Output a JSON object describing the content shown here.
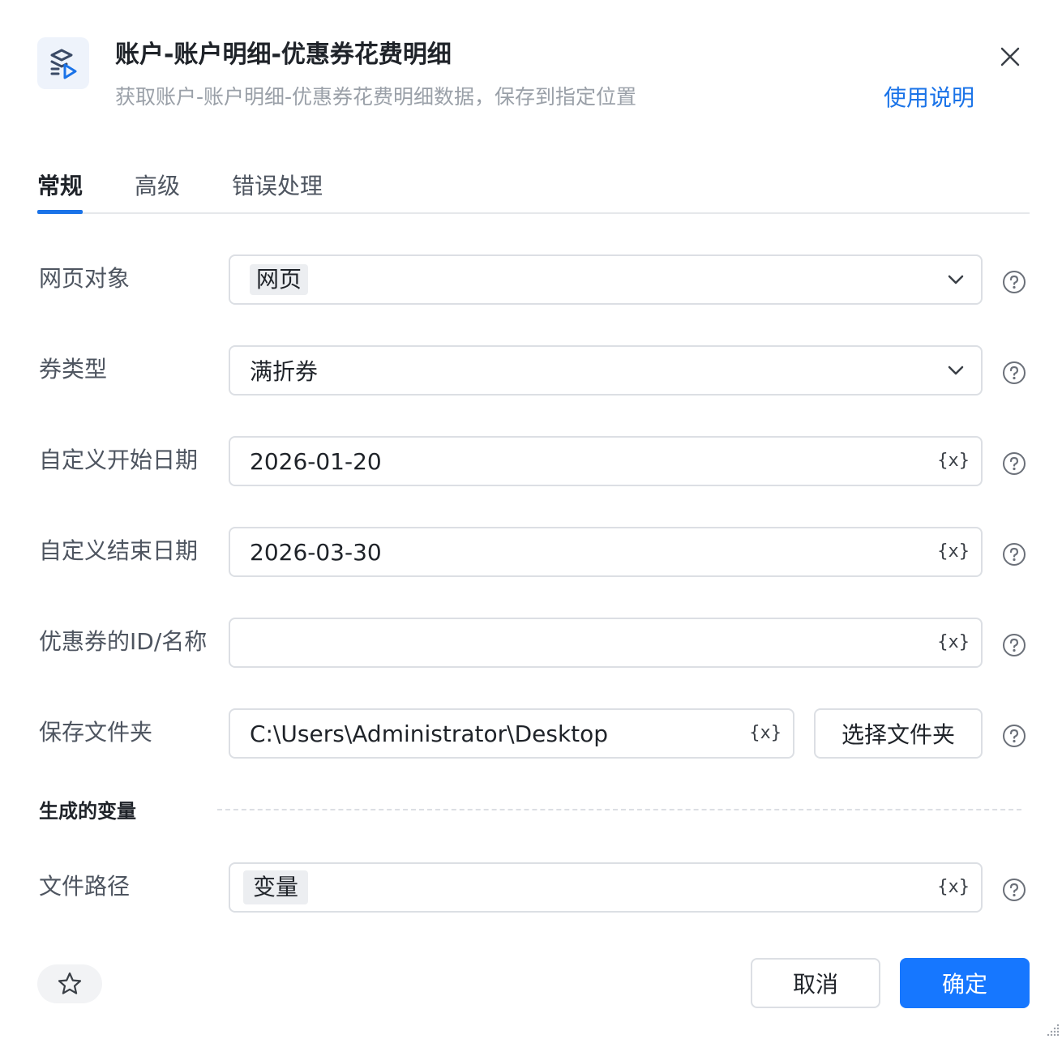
{
  "header": {
    "title": "账户-账户明细-优惠券花费明细",
    "subtitle": "获取账户-账户明细-优惠券花费明细数据，保存到指定位置",
    "help_link": "使用说明",
    "icon": "data-flow-icon",
    "close_icon": "close-icon"
  },
  "tabs": [
    {
      "label": "常规",
      "active": true
    },
    {
      "label": "高级",
      "active": false
    },
    {
      "label": "错误处理",
      "active": false
    }
  ],
  "fields": {
    "page_object": {
      "label": "网页对象",
      "value": "网页"
    },
    "coupon_type": {
      "label": "券类型",
      "value": "满折券"
    },
    "start_date": {
      "label": "自定义开始日期",
      "value": "2026-01-20"
    },
    "end_date": {
      "label": "自定义结束日期",
      "value": "2026-03-30"
    },
    "coupon_id": {
      "label": "优惠券的ID/名称",
      "value": ""
    },
    "save_folder": {
      "label": "保存文件夹",
      "value": "C:\\Users\\Administrator\\Desktop",
      "button": "选择文件夹"
    }
  },
  "generated": {
    "section_title": "生成的变量",
    "file_path": {
      "label": "文件路径",
      "value": "变量"
    }
  },
  "variable_marker": "{x}",
  "footer": {
    "cancel": "取消",
    "confirm": "确定",
    "favorite_icon": "star-icon"
  },
  "colors": {
    "accent": "#1677ff",
    "link": "#1a73e8",
    "border": "#dcdfe4"
  }
}
